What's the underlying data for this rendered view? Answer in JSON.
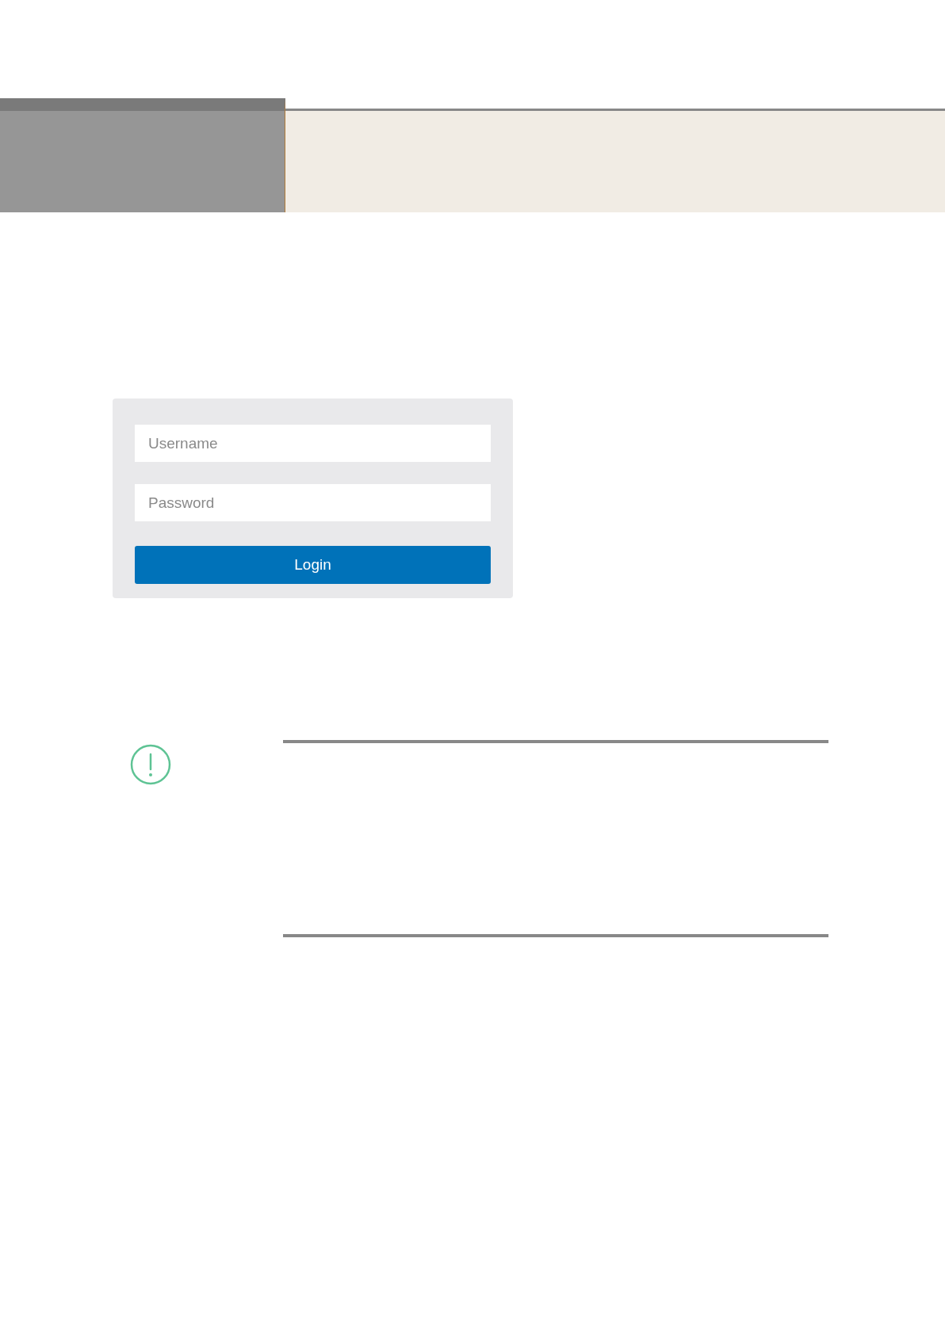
{
  "login_form": {
    "fields": [
      {
        "placeholder": "Username"
      },
      {
        "placeholder": "Password"
      }
    ],
    "button": "Login"
  }
}
